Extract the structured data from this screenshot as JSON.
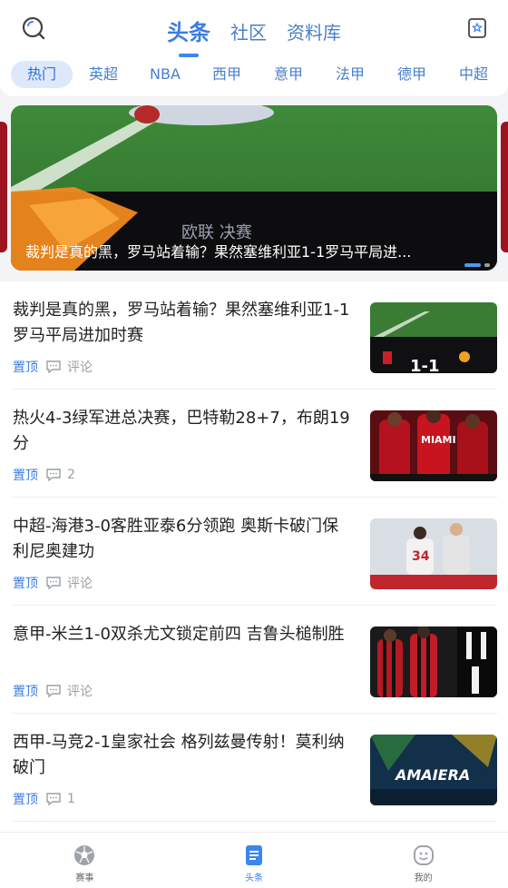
{
  "header": {
    "tabs": [
      {
        "label": "头条",
        "active": true
      },
      {
        "label": "社区",
        "active": false
      },
      {
        "label": "资料库",
        "active": false
      }
    ],
    "search_icon": "search-icon",
    "bookmark_icon": "bookmark-star-icon"
  },
  "categories": [
    "热门",
    "英超",
    "NBA",
    "西甲",
    "意甲",
    "法甲",
    "德甲",
    "中超"
  ],
  "active_category": "热门",
  "banner": {
    "overlay_text": "欧联 决赛",
    "caption": "裁判是真的黑，罗马站着输？果然塞维利亚1-1罗马平局进..."
  },
  "news": [
    {
      "title": "裁判是真的黑，罗马站着输？果然塞维利亚1-1罗马平局进加时赛",
      "pin": "置顶",
      "comments": "评论",
      "thumb_text": "1-1"
    },
    {
      "title": "热火4-3绿军进总决赛，巴特勒28+7，布朗19分",
      "pin": "置顶",
      "comments": "2",
      "thumb_text": "MIAMI"
    },
    {
      "title": "中超-海港3-0客胜亚泰6分领跑 奥斯卡破门保利尼奥建功",
      "pin": "置顶",
      "comments": "评论",
      "thumb_text": "34"
    },
    {
      "title": "意甲-米兰1-0双杀尤文锁定前四 吉鲁头槌制胜",
      "pin": "置顶",
      "comments": "评论",
      "thumb_text": ""
    },
    {
      "title": "西甲-马竞2-1皇家社会 格列兹曼传射！莫利纳破门",
      "pin": "置顶",
      "comments": "1",
      "thumb_text": "AMAIERA"
    }
  ],
  "bottom_nav": [
    {
      "label": "赛事",
      "icon": "soccer-ball-icon",
      "active": false
    },
    {
      "label": "头条",
      "icon": "news-doc-icon",
      "active": true
    },
    {
      "label": "我的",
      "icon": "profile-face-icon",
      "active": false
    }
  ]
}
